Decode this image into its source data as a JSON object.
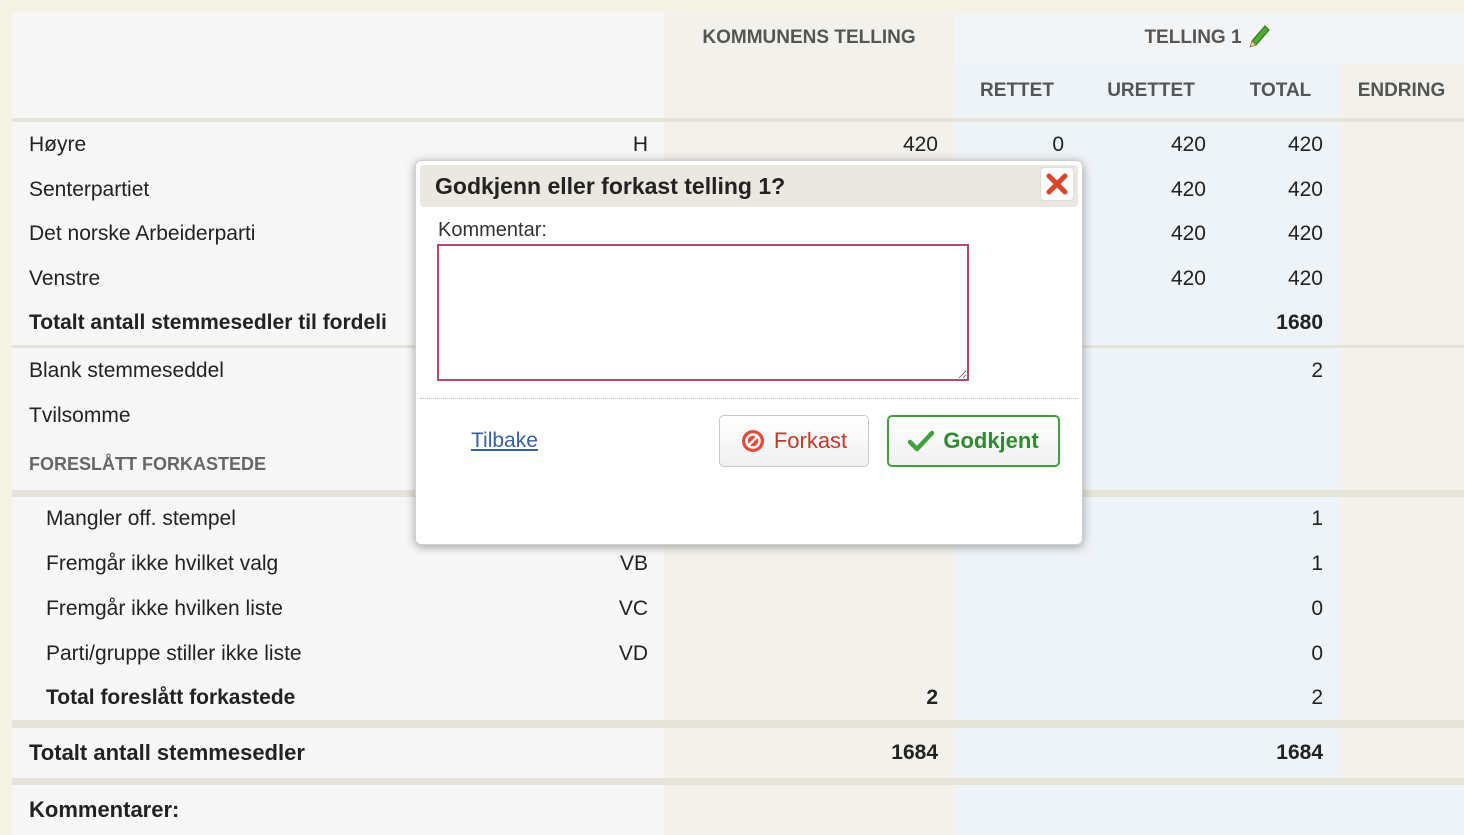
{
  "header": {
    "komm": "KOMMUNENS TELLING",
    "telling": "TELLING 1",
    "rettet": "RETTET",
    "urettet": "URETTET",
    "total": "TOTAL",
    "endring": "ENDRING"
  },
  "rows": [
    {
      "label": "Høyre",
      "code": "H",
      "komm": "420",
      "rettet": "0",
      "urettet": "420",
      "total": "420"
    },
    {
      "label": "Senterpartiet",
      "code": "",
      "komm": "",
      "rettet": "",
      "urettet": "420",
      "total": "420"
    },
    {
      "label": "Det norske Arbeiderparti",
      "code": "",
      "komm": "",
      "rettet": "",
      "urettet": "420",
      "total": "420"
    },
    {
      "label": "Venstre",
      "code": "",
      "komm": "",
      "rettet": "",
      "urettet": "420",
      "total": "420"
    },
    {
      "label": "Totalt antall stemmesedler til fordeli",
      "code": "",
      "komm": "",
      "rettet": "",
      "urettet": "",
      "total": "1680"
    },
    {
      "label": "Blank stemmeseddel",
      "code": "",
      "komm": "",
      "rettet": "",
      "urettet": "",
      "total": "2"
    },
    {
      "label": "Tvilsomme",
      "code": "",
      "komm": "",
      "rettet": "",
      "urettet": "",
      "total": ""
    }
  ],
  "section_label": "FORESLÅTT FORKASTEDE",
  "reject_rows": [
    {
      "label": "Mangler off. stempel",
      "code": "",
      "komm": "",
      "total": "1"
    },
    {
      "label": "Fremgår ikke hvilket valg",
      "code": "VB",
      "komm": "",
      "total": "1"
    },
    {
      "label": "Fremgår ikke hvilken liste",
      "code": "VC",
      "komm": "",
      "total": "0"
    },
    {
      "label": "Parti/gruppe stiller ikke liste",
      "code": "VD",
      "komm": "",
      "total": "0"
    },
    {
      "label": "Total foreslått forkastede",
      "code": "",
      "komm": "2",
      "total": "2"
    }
  ],
  "grand_total": {
    "label": "Totalt antall stemmesedler",
    "komm": "1684",
    "total": "1684"
  },
  "comments_label": "Kommentarer:",
  "dialog": {
    "title": "Godkjenn eller forkast telling 1?",
    "comment_label": "Kommentar:",
    "comment_value": "",
    "back_label": "Tilbake",
    "reject_label": "Forkast",
    "approve_label": "Godkjent"
  },
  "colors": {
    "accent_green": "#3ea03e",
    "accent_red": "#d9442b",
    "link": "#3a5f9e"
  }
}
